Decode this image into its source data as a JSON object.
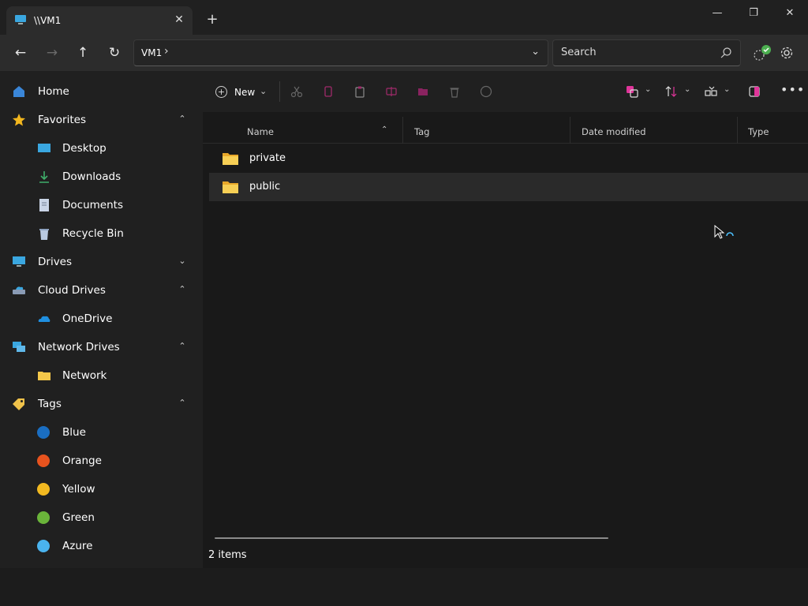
{
  "window": {
    "tab_title": "\\\\VM1",
    "tab_close": "✕",
    "new_tab": "+",
    "minimize": "—",
    "maximize": "❐",
    "close": "✕"
  },
  "address": {
    "back": "←",
    "forward": "→",
    "up": "↑",
    "refresh": "↻",
    "crumb": "VM1",
    "crumb_sep": "›",
    "dropdown": "⌄",
    "search_placeholder": "Search"
  },
  "sidebar": {
    "items": [
      {
        "label": "Home"
      },
      {
        "label": "Favorites",
        "chevron": "⌃"
      },
      {
        "label": "Desktop"
      },
      {
        "label": "Downloads"
      },
      {
        "label": "Documents"
      },
      {
        "label": "Recycle Bin"
      },
      {
        "label": "Drives",
        "chevron": "⌄"
      },
      {
        "label": "Cloud Drives",
        "chevron": "⌃"
      },
      {
        "label": "OneDrive"
      },
      {
        "label": "Network Drives",
        "chevron": "⌃"
      },
      {
        "label": "Network"
      },
      {
        "label": "Tags",
        "chevron": "⌃"
      },
      {
        "label": "Blue",
        "color": "#1a6ec2"
      },
      {
        "label": "Orange",
        "color": "#e8531e"
      },
      {
        "label": "Yellow",
        "color": "#f2b920"
      },
      {
        "label": "Green",
        "color": "#6ab43a"
      },
      {
        "label": "Azure",
        "color": "#4ab3ee"
      }
    ]
  },
  "toolbar": {
    "new_label": "New",
    "plus": "+",
    "drop": "⌄",
    "more": "•••"
  },
  "columns": {
    "name": "Name",
    "tag": "Tag",
    "date_modified": "Date modified",
    "type": "Type",
    "sort_indicator": "⌃"
  },
  "files": [
    {
      "name": "private"
    },
    {
      "name": "public"
    }
  ],
  "status": {
    "item_count": "2 items"
  },
  "colors": {
    "accent": "#4cc2ff",
    "pink_icon": "#e0359a",
    "folder": "#f5c84a"
  }
}
